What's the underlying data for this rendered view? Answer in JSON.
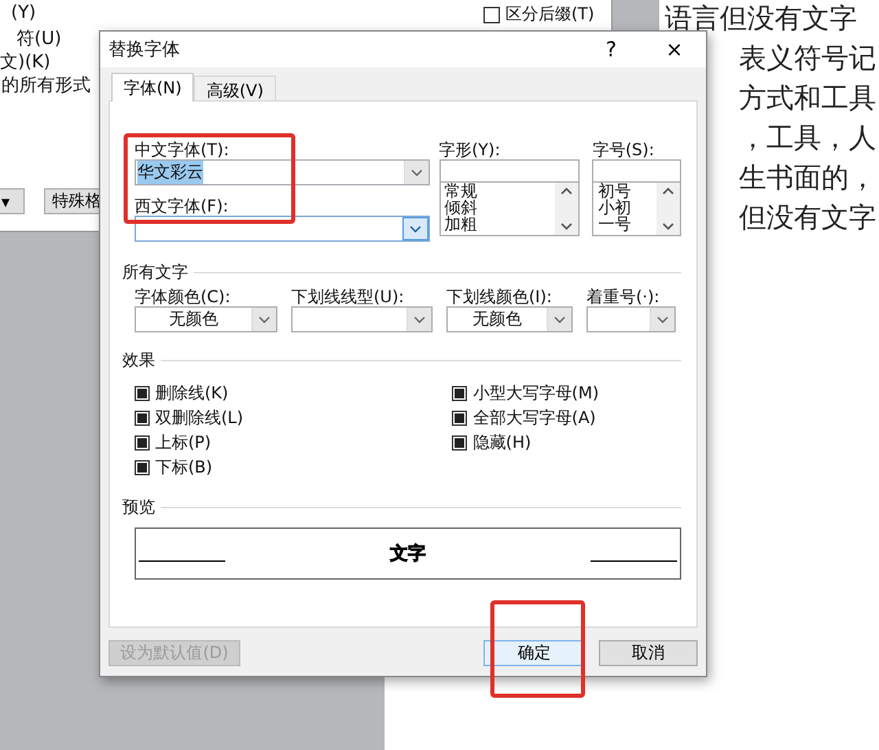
{
  "back_dialog": {
    "lines": [
      "(Y)",
      "符(U)",
      "文)(K)",
      "的所有形式"
    ],
    "checkboxes": [
      {
        "label": "区分后缀(T)",
        "checked": false
      }
    ],
    "buttons": [
      {
        "label": "▾"
      },
      {
        "label": "特殊格"
      }
    ]
  },
  "document": {
    "lines": [
      "语言但没有文字",
      "表义符号记",
      "方式和工具",
      "，工具，人",
      "生书面的，",
      "但没有文字"
    ]
  },
  "dialog": {
    "title": "替换字体",
    "help": "?",
    "close": "×",
    "tabs": [
      {
        "label": "字体(N)",
        "selected": true
      },
      {
        "label": "高级(V)",
        "selected": false
      }
    ],
    "chinese_font": {
      "label": "中文字体(T):",
      "value": "华文彩云",
      "highlighted": true,
      "focused": false
    },
    "western_font": {
      "label": "西文字体(F):",
      "focused": true
    },
    "style": {
      "label": "字形(Y):",
      "items": [
        "常规",
        "倾斜",
        "加粗"
      ]
    },
    "size": {
      "label": "字号(S):",
      "items": [
        "初号",
        "小初",
        "一号"
      ]
    },
    "all_text": {
      "heading": "所有文字",
      "combos": [
        {
          "label": "字体颜色(C):",
          "value": "无颜色"
        },
        {
          "label": "下划线线型(U):"
        },
        {
          "label": "下划线颜色(I):",
          "value": "无颜色"
        },
        {
          "label": "着重号(·):"
        }
      ]
    },
    "effects": {
      "heading": "效果",
      "left": [
        {
          "label": "删除线(K)",
          "indeterminate": true
        },
        {
          "label": "双删除线(L)",
          "indeterminate": true
        },
        {
          "label": "上标(P)",
          "indeterminate": true
        },
        {
          "label": "下标(B)",
          "indeterminate": true
        }
      ],
      "right": [
        {
          "label": "小型大写字母(M)",
          "indeterminate": true
        },
        {
          "label": "全部大写字母(A)",
          "indeterminate": true
        },
        {
          "label": "隐藏(H)",
          "indeterminate": true
        }
      ]
    },
    "preview": {
      "heading": "预览",
      "sample": "文字"
    },
    "buttons": [
      {
        "label": "设为默认值(D)",
        "disabled": true
      },
      {
        "label": "确定",
        "disabled": false
      },
      {
        "label": "取消",
        "disabled": false
      }
    ]
  },
  "annotations": [
    {
      "kind": "highlight-box"
    },
    {
      "kind": "highlight-box"
    }
  ]
}
